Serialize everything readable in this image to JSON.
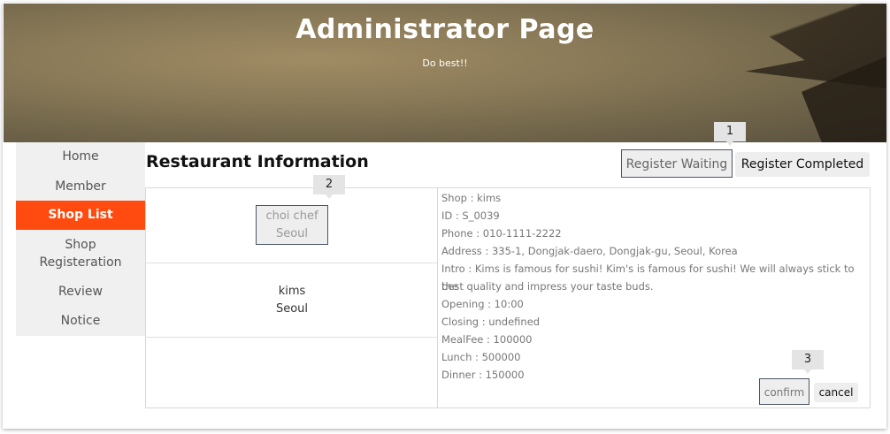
{
  "header": {
    "title": "Administrator Page",
    "subtitle": "Do best!!"
  },
  "sidebar": {
    "items": [
      {
        "label": "Home",
        "active": false
      },
      {
        "label": "Member",
        "active": false
      },
      {
        "label": "Shop List",
        "active": true
      },
      {
        "label": "Shop\nRegisteration",
        "active": false
      },
      {
        "label": "Review",
        "active": false
      },
      {
        "label": "Notice",
        "active": false
      }
    ]
  },
  "main": {
    "title": "Restaurant Information",
    "tabs": {
      "waiting": "Register Waiting",
      "completed": "Register Completed"
    },
    "shops": [
      {
        "name": "choi chef",
        "city": "Seoul",
        "selected": true
      },
      {
        "name": "kims",
        "city": "Seoul",
        "selected": false
      }
    ],
    "details": [
      "Shop : kims",
      "ID : S_0039",
      "Phone : 010-1111-2222",
      "Address : 335-1, Dongjak-daero, Dongjak-gu, Seoul, Korea",
      "Intro : Kims is famous for sushi! Kim's is famous for sushi! We will always stick to the",
      "best quality and impress your taste buds.",
      "Opening : 10:00",
      "Closing : undefined",
      "MealFee : 100000",
      "Lunch : 500000",
      "Dinner : 150000"
    ],
    "actions": {
      "confirm": "confirm",
      "cancel": "cancel"
    }
  },
  "callouts": [
    "1",
    "2",
    "3"
  ],
  "colors": {
    "accent": "#ff4a10",
    "sidebar_bg": "#f0f0f0",
    "selected_border": "#4a5566"
  }
}
